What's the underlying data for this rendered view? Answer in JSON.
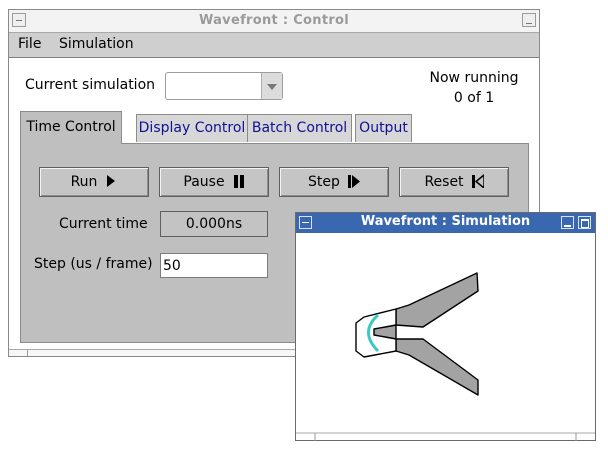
{
  "control_window": {
    "title": "Wavefront : Control",
    "menu": [
      "File",
      "Simulation"
    ],
    "current_simulation_label": "Current simulation",
    "current_simulation_value": "",
    "status": {
      "line1": "Now running",
      "line2": "0 of 1"
    },
    "tabs": [
      "Time Control",
      "Display Control",
      "Batch Control",
      "Output"
    ],
    "active_tab": "Time Control",
    "buttons": {
      "run": "Run",
      "pause": "Pause",
      "step": "Step",
      "reset": "Reset"
    },
    "current_time_label": "Current time",
    "current_time_value": "0.000ns",
    "step_label": "Step (us / frame)",
    "step_value": "50"
  },
  "simulation_window": {
    "title": "Wavefront : Simulation"
  },
  "colors": {
    "sim_titlebar": "#3a68b0",
    "panel": "#bfbfbf",
    "tab_link": "#101094",
    "wavefront": "#3cc9c4",
    "shape_fill": "#a3a3a3"
  }
}
